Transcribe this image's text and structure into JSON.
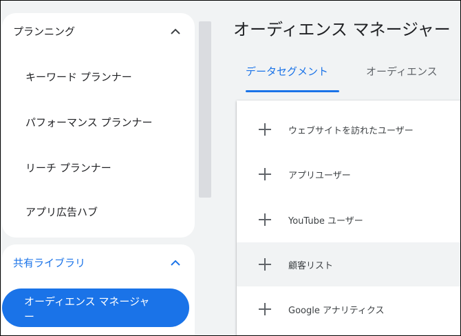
{
  "sidebar": {
    "planning": {
      "title": "プランニング",
      "items": [
        "キーワード プランナー",
        "パフォーマンス プランナー",
        "リーチ プランナー",
        "アプリ広告ハブ"
      ]
    },
    "shared_library": {
      "title": "共有ライブラリ",
      "active_item_line1": "オーディエンス マネージャ",
      "active_item_line2": "ー"
    }
  },
  "main": {
    "title": "オーディエンス マネージャー",
    "tabs": [
      "データセグメント",
      "オーディエンス"
    ],
    "segments": [
      {
        "label": "ウェブサイトを訪れたユーザー"
      },
      {
        "label": "アプリユーザー"
      },
      {
        "label": "YouTube ユーザー"
      },
      {
        "label": "顧客リスト"
      },
      {
        "label": "Google アナリティクス"
      }
    ]
  },
  "colors": {
    "accent": "#1a73e8",
    "background": "#f1f3f4",
    "icon": "#5f6368"
  }
}
